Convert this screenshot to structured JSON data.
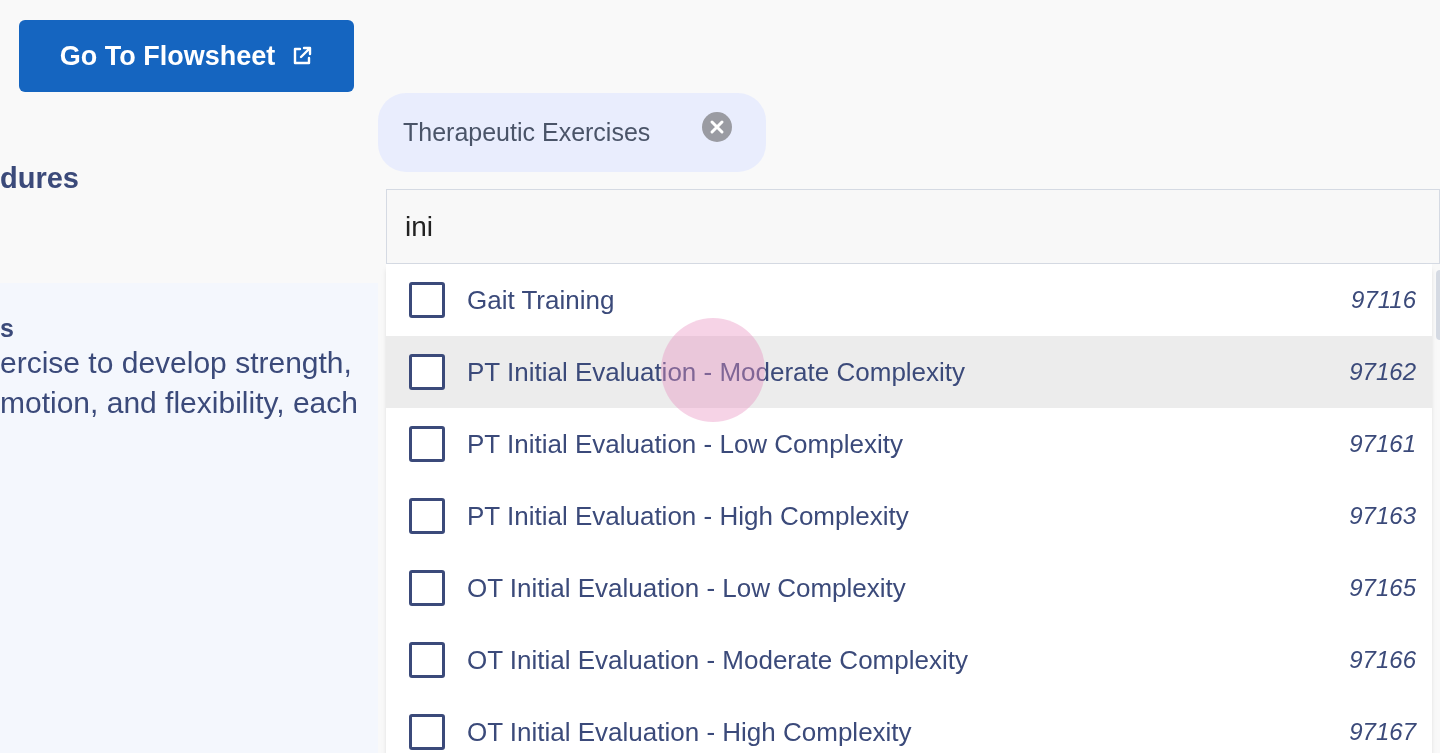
{
  "flowsheet_button": {
    "label": "Go To Flowsheet"
  },
  "section_heading": "dures",
  "panel": {
    "title": "s",
    "description_lines": [
      "ercise to develop strength,",
      "motion, and flexibility, each"
    ]
  },
  "selected_chip": {
    "label": "Therapeutic Exercises"
  },
  "search": {
    "value": "ini"
  },
  "options": [
    {
      "label": "Gait Training",
      "code": "97116",
      "checked": false,
      "hovered": false
    },
    {
      "label": "PT Initial Evaluation - Moderate Complexity",
      "code": "97162",
      "checked": false,
      "hovered": true
    },
    {
      "label": "PT Initial Evaluation - Low Complexity",
      "code": "97161",
      "checked": false,
      "hovered": false
    },
    {
      "label": "PT Initial Evaluation - High Complexity",
      "code": "97163",
      "checked": false,
      "hovered": false
    },
    {
      "label": "OT Initial Evaluation - Low Complexity",
      "code": "97165",
      "checked": false,
      "hovered": false
    },
    {
      "label": "OT Initial Evaluation - Moderate Complexity",
      "code": "97166",
      "checked": false,
      "hovered": false
    },
    {
      "label": "OT Initial Evaluation - High Complexity",
      "code": "97167",
      "checked": false,
      "hovered": false
    }
  ]
}
